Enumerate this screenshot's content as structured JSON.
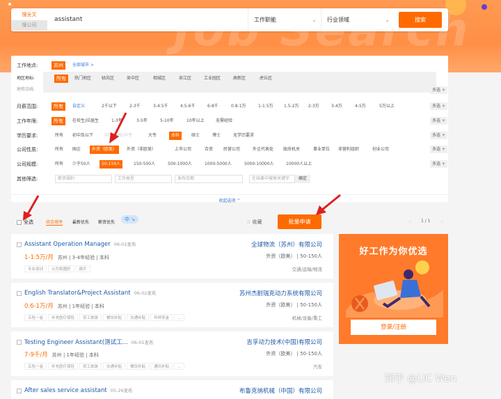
{
  "hero": {
    "bg_text": "Job Search"
  },
  "search": {
    "tab_active": "搜全文",
    "tab_inactive": "搜公司",
    "keyword": "assistant",
    "job_function": "工作职能",
    "industry": "行业领域",
    "search_btn": "搜索"
  },
  "filters": {
    "work_location_label": "工作地点:",
    "work_location_value": "苏州",
    "all_cities": "全部城市 >",
    "area_label": "地区地标:",
    "area_options": [
      "所有",
      "热门地区",
      "姑苏区",
      "吴中区",
      "相城区",
      "吴江区",
      "工业园区",
      "高新区",
      "虎丘区"
    ],
    "subway_label": "地铁沿线:",
    "more": "多选 +",
    "salary_label": "月薪范围:",
    "salary_options": [
      "所有",
      "自定义",
      "2千以下",
      "2-3千",
      "3-4.5千",
      "4.5-6千",
      "6-8千",
      "0.8-1万",
      "1-1.5万",
      "1.5-2万",
      "2-3万",
      "3-4万",
      "4-5万",
      "5万以上"
    ],
    "years_label": "工作年限:",
    "years_options": [
      "所有",
      "在校生/应届生",
      "1-3年",
      "3-5年",
      "5-10年",
      "10年以上",
      "无需经验"
    ],
    "edu_label": "学历要求:",
    "edu_options": [
      "所有",
      "初中及以下",
      "中专/中技/中专",
      "大专",
      "本科",
      "硕士",
      "博士",
      "无学历要求"
    ],
    "nature_label": "公司性质:",
    "nature_options": [
      "所有",
      "国企",
      "外资（欧美）",
      "外资（非欧美）",
      "上市公司",
      "合资",
      "民营公司",
      "外企代表处",
      "政府机关",
      "事业单位",
      "非营利组织",
      "创业公司"
    ],
    "scale_label": "公司规模:",
    "scale_options": [
      "所有",
      "少于50人",
      "50-150人",
      "150-500人",
      "500-1000人",
      "1000-5000人",
      "5000-10000人",
      "10000人以上"
    ],
    "other_label": "其他筛选:",
    "other_dropdowns": [
      "薪资福利",
      "工作类型",
      "发布日期"
    ],
    "company_search_placeholder": "在结果中搜索关键字",
    "confirm": "确定",
    "collapse": "收起选项 ^"
  },
  "toolbar": {
    "select_all": "全选",
    "sort_default": "综合排序",
    "sort_latest": "最新优先",
    "sort_salary": "薪资优先",
    "lang_badge": "中 ↘",
    "favorite": "收藏",
    "batch_apply": "批量申请",
    "pager": "1 / 1"
  },
  "jobs": [
    {
      "title": "Assistant Operation Manager",
      "date": "06-02发布",
      "company": "全球物流（苏州）有限公司",
      "salary": "1-1.5万/月",
      "meta": "苏州 | 3-4年经验 | 本科",
      "company_info": "外资（欧美） | 50-150人",
      "tags": [
        "专业培训",
        "公司氛围好",
        "扁平"
      ],
      "industry": "交通/运输/物流"
    },
    {
      "title": "English Translator&Project Assistant",
      "date": "06-02发布",
      "company": "苏州杰耐瑞克动力系统有限公司",
      "salary": "0.6-1万/月",
      "meta": "苏州 | 1年经验 | 本科",
      "company_info": "外资（欧美） | 50-150人",
      "tags": [
        "五险一金",
        "补充医疗保险",
        "员工旅游",
        "餐饮补贴",
        "交通补贴",
        "年终奖金",
        "..."
      ],
      "industry": "机械/设备/重工"
    },
    {
      "title": "Testing Engineer Assistant(测试工...",
      "date": "06-01发布",
      "company": "吉孚动力技术(中国)有限公司",
      "salary": "7-9千/月",
      "meta": "苏州 | 1年经验 | 本科",
      "company_info": "外资（欧美） | 50-150人",
      "tags": [
        "五险一金",
        "补充医疗保险",
        "员工旅游",
        "交通补贴",
        "餐饮补贴",
        "通讯补贴",
        "..."
      ],
      "industry": "汽车"
    },
    {
      "title": "After sales service assistant",
      "date": "05-26发布",
      "company": "布鲁克纳机械（中国）有限公司"
    }
  ],
  "ad": {
    "title": "好工作为你优选",
    "login": "登录/注册"
  },
  "watermark": "知乎 @LiC Wen"
}
